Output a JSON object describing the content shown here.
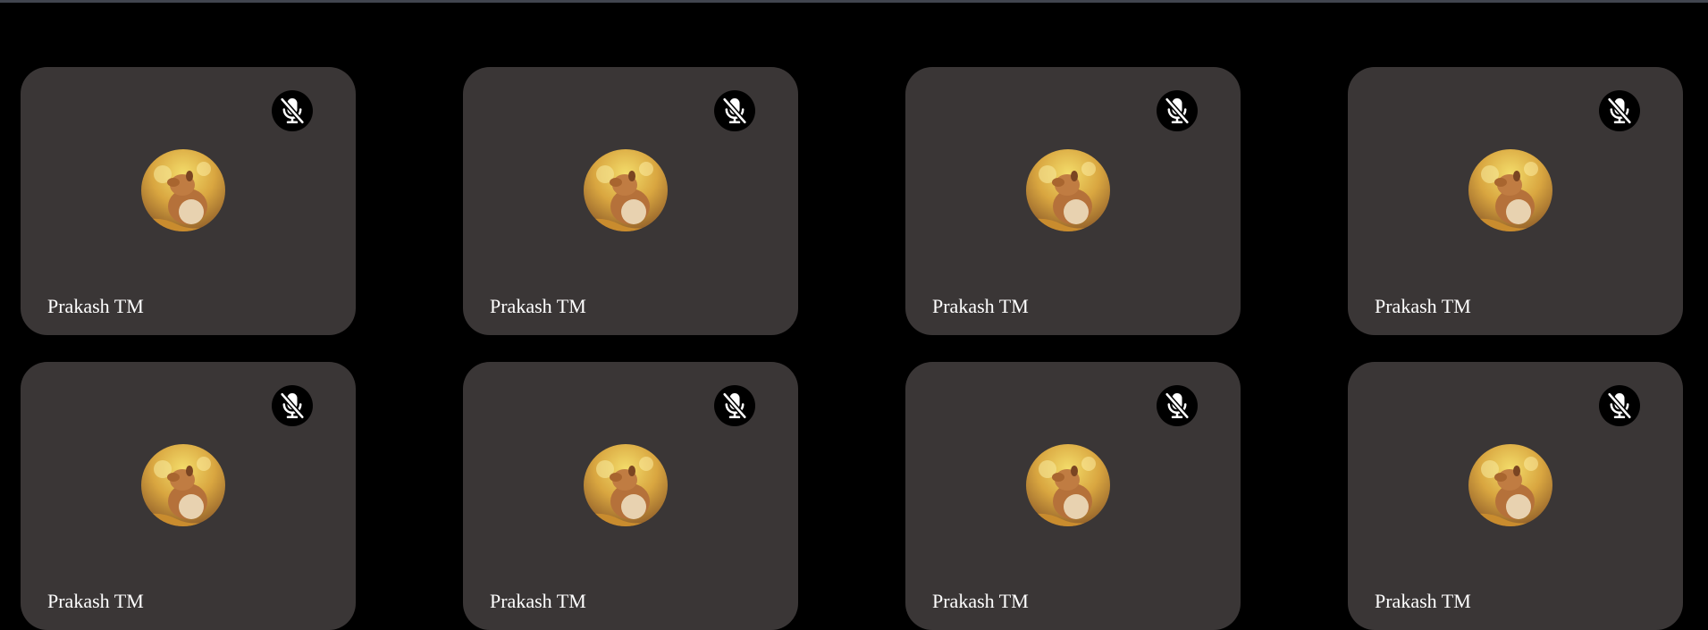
{
  "participants": [
    {
      "name": "Prakash TM",
      "muted": true,
      "avatar": "dog-photo"
    },
    {
      "name": "Prakash TM",
      "muted": true,
      "avatar": "dog-photo"
    },
    {
      "name": "Prakash TM",
      "muted": true,
      "avatar": "dog-photo"
    },
    {
      "name": "Prakash TM",
      "muted": true,
      "avatar": "dog-photo"
    },
    {
      "name": "Prakash TM",
      "muted": true,
      "avatar": "dog-photo"
    },
    {
      "name": "Prakash TM",
      "muted": true,
      "avatar": "dog-photo"
    },
    {
      "name": "Prakash TM",
      "muted": true,
      "avatar": "dog-photo"
    },
    {
      "name": "Prakash TM",
      "muted": true,
      "avatar": "dog-photo"
    }
  ],
  "icons": {
    "mute": "mic-off-icon"
  },
  "colors": {
    "background": "#000000",
    "tile": "#3a3636",
    "name_text": "#ffffff",
    "mute_badge": "#000000"
  }
}
